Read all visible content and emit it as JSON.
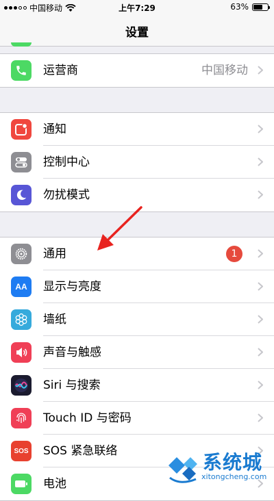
{
  "status_bar": {
    "carrier": "中国移动",
    "time": "上午7:29",
    "battery_percent": "63%",
    "battery_level": 0.63
  },
  "nav": {
    "title": "设置"
  },
  "groups": [
    {
      "items": [
        {
          "label": "运营商",
          "value": "中国移动",
          "icon": "phone-icon",
          "color": "#4cd964"
        }
      ]
    },
    {
      "items": [
        {
          "label": "通知",
          "icon": "notifications-icon",
          "color": "#f0473e"
        },
        {
          "label": "控制中心",
          "icon": "control-center-icon",
          "color": "#8e8e93"
        },
        {
          "label": "勿扰模式",
          "icon": "moon-icon",
          "color": "#5856d6"
        }
      ]
    },
    {
      "items": [
        {
          "label": "通用",
          "badge": "1",
          "icon": "gear-icon",
          "color": "#8e8e93"
        },
        {
          "label": "显示与亮度",
          "icon": "text-size-icon",
          "glyph": "AA",
          "color": "#1e7cf2"
        },
        {
          "label": "墙纸",
          "icon": "flower-icon",
          "color": "#36aadc"
        },
        {
          "label": "声音与触感",
          "icon": "speaker-icon",
          "color": "#f03f56"
        },
        {
          "label": "Siri 与搜索",
          "icon": "siri-icon",
          "color": "#1b1b2f"
        },
        {
          "label": "Touch ID 与密码",
          "icon": "fingerprint-icon",
          "color": "#f03f56"
        },
        {
          "label": "SOS 紧急联络",
          "icon": "sos-icon",
          "glyph": "SOS",
          "color": "#e8412f"
        },
        {
          "label": "电池",
          "icon": "battery-icon",
          "color": "#4cd964"
        }
      ]
    }
  ],
  "watermark": {
    "title": "系统城",
    "url": "xitongcheng.com"
  }
}
